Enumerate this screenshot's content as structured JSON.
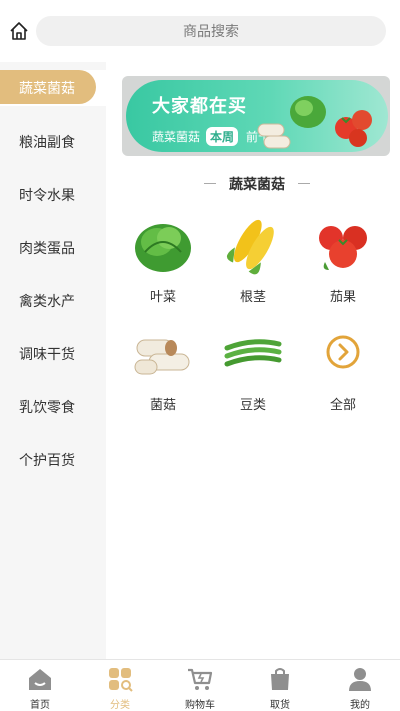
{
  "header": {
    "search_placeholder": "商品搜索"
  },
  "sidebar": {
    "items": [
      {
        "label": "蔬菜菌菇",
        "active": true
      },
      {
        "label": "粮油副食"
      },
      {
        "label": "时令水果"
      },
      {
        "label": "肉类蛋品"
      },
      {
        "label": "禽类水产"
      },
      {
        "label": "调味干货"
      },
      {
        "label": "乳饮零食"
      },
      {
        "label": "个护百货"
      }
    ]
  },
  "banner": {
    "title": "大家都在买",
    "category": "蔬菜菌菇",
    "tag": "本周",
    "rank": "前十"
  },
  "section": {
    "title": "蔬菜菌菇"
  },
  "categories": [
    {
      "label": "叶菜",
      "icon": "lettuce-icon"
    },
    {
      "label": "根茎",
      "icon": "corn-icon"
    },
    {
      "label": "茄果",
      "icon": "tomato-icon"
    },
    {
      "label": "菌菇",
      "icon": "mushroom-icon"
    },
    {
      "label": "豆类",
      "icon": "beans-icon"
    },
    {
      "label": "全部",
      "icon": "chevron-right-icon"
    }
  ],
  "tabbar": [
    {
      "label": "首页",
      "icon": "home-icon"
    },
    {
      "label": "分类",
      "icon": "category-icon",
      "active": true
    },
    {
      "label": "购物车",
      "icon": "cart-icon"
    },
    {
      "label": "取货",
      "icon": "bag-icon"
    },
    {
      "label": "我的",
      "icon": "user-icon"
    }
  ],
  "colors": {
    "accent": "#e2bd7e",
    "banner_green": "#39c8a2",
    "sidebar_bg": "#f6f6f6"
  }
}
